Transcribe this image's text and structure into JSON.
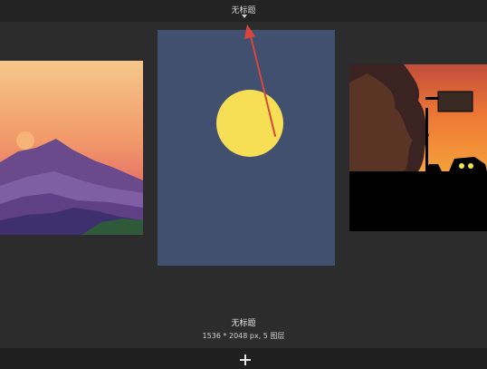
{
  "header": {
    "title": "无标题"
  },
  "document": {
    "name": "无标题",
    "meta": "1536 * 2048 px, 5 图层"
  },
  "toolbar": {
    "add_icon": "plus-icon"
  },
  "colors": {
    "background": "#2a2a2a",
    "canvas_blue": "#41506f",
    "sun_yellow": "#f6df55",
    "annotation_red": "#d9463c"
  }
}
